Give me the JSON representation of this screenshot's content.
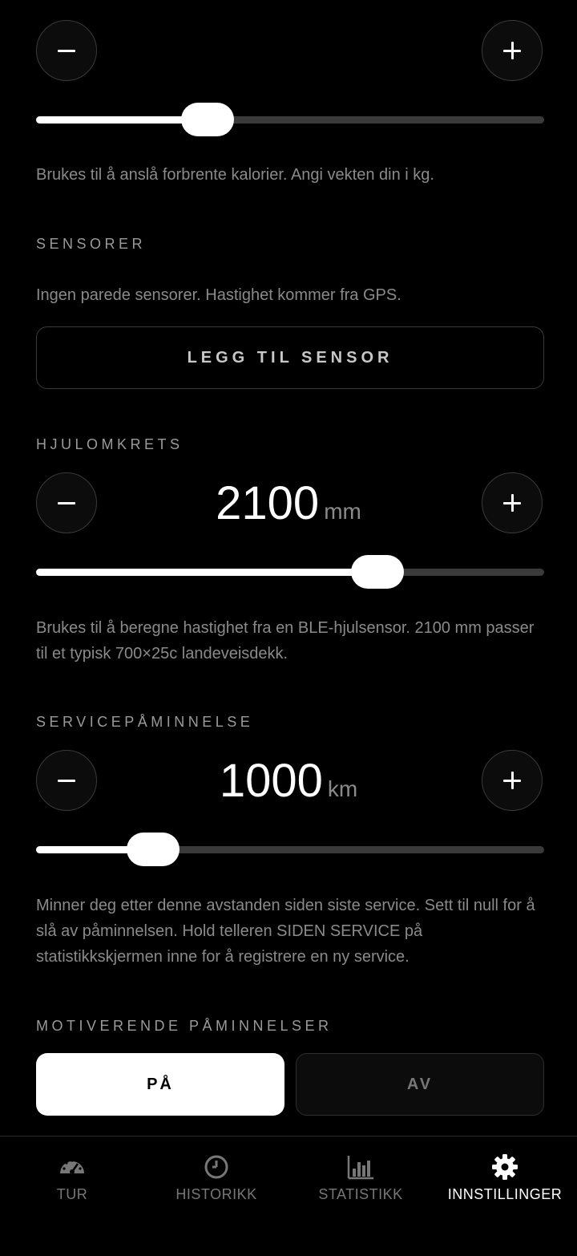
{
  "weight": {
    "minus": "−",
    "plus": "+",
    "help": "Brukes til å anslå forbrente kalorier. Angi vekten din i kg.",
    "level": 0.337
  },
  "sensors": {
    "label": "SENSORER",
    "status": "Ingen parede sensorer. Hastighet kommer fra GPS.",
    "add_button": "LEGG TIL SENSOR"
  },
  "wheel": {
    "label": "HJULOMKRETS",
    "value": "2100",
    "unit": "mm",
    "level": 0.672,
    "help": "Brukes til å beregne hastighet fra en BLE-hjulsensor. 2100 mm passer til et typisk 700×25c landeveisdekk."
  },
  "service": {
    "label": "SERVICEPÅMINNELSE",
    "value": "1000",
    "unit": "km",
    "level": 0.23,
    "help": "Minner deg etter denne avstanden siden siste service. Sett til null for å slå av påminnelsen. Hold telleren SIDEN SERVICE på statistikkskjermen inne for å registrere en ny service."
  },
  "motivation": {
    "label": "MOTIVERENDE PÅMINNELSER",
    "on": "PÅ",
    "off": "AV",
    "selected": "on"
  },
  "tabs": [
    {
      "label": "TUR",
      "icon": "speedometer-icon"
    },
    {
      "label": "HISTORIKK",
      "icon": "clock-icon"
    },
    {
      "label": "STATISTIKK",
      "icon": "bar-chart-icon"
    },
    {
      "label": "INNSTILLINGER",
      "icon": "gear-icon",
      "active": true
    }
  ],
  "colors": {
    "background": "#000000",
    "accent": "#ffffff",
    "track": "#3a3a3a",
    "muted": "#8a8a8a"
  }
}
